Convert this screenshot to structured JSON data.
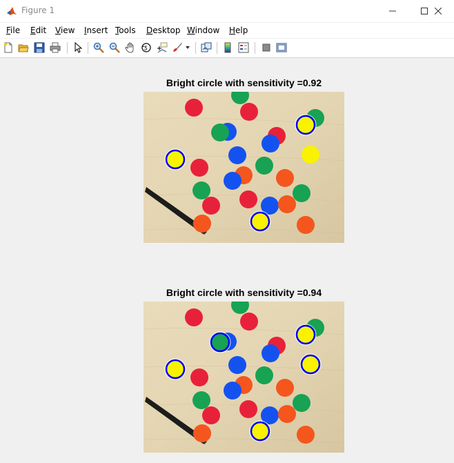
{
  "window": {
    "title": "Figure 1"
  },
  "menu": [
    {
      "key": "F",
      "rest": "ile"
    },
    {
      "key": "E",
      "rest": "dit"
    },
    {
      "key": "V",
      "rest": "iew"
    },
    {
      "key": "I",
      "rest": "nsert"
    },
    {
      "key": "T",
      "rest": "ools"
    },
    {
      "key": "D",
      "rest": "esktop"
    },
    {
      "key": "W",
      "rest": "indow"
    },
    {
      "key": "H",
      "rest": "elp"
    }
  ],
  "toolbar": [
    "new-figure-icon",
    "open-file-icon",
    "save-icon",
    "print-icon",
    "pointer-icon",
    "zoom-in-icon",
    "zoom-out-icon",
    "pan-hand-icon",
    "rotate-3d-icon",
    "data-cursor-icon",
    "brush-icon",
    "link-plot-icon",
    "colorbar-icon",
    "legend-icon",
    "hide-plot-tools-icon",
    "show-plot-tools-icon"
  ],
  "plots": [
    {
      "title": "Bright circle with sensitivity =0.92",
      "detected": [
        "yellow",
        "yellow",
        "yellow"
      ]
    },
    {
      "title": "Bright circle with sensitivity =0.94",
      "detected": [
        "yellow",
        "yellow",
        "yellow",
        "yellow",
        "green"
      ]
    }
  ],
  "colors": {
    "red": "#e8213a",
    "green": "#18a253",
    "blue": "#1452f0",
    "orange": "#f4561e",
    "yellow": "#f9f200",
    "circle_outline": "#0000ff",
    "table": "#e3d5b3"
  }
}
